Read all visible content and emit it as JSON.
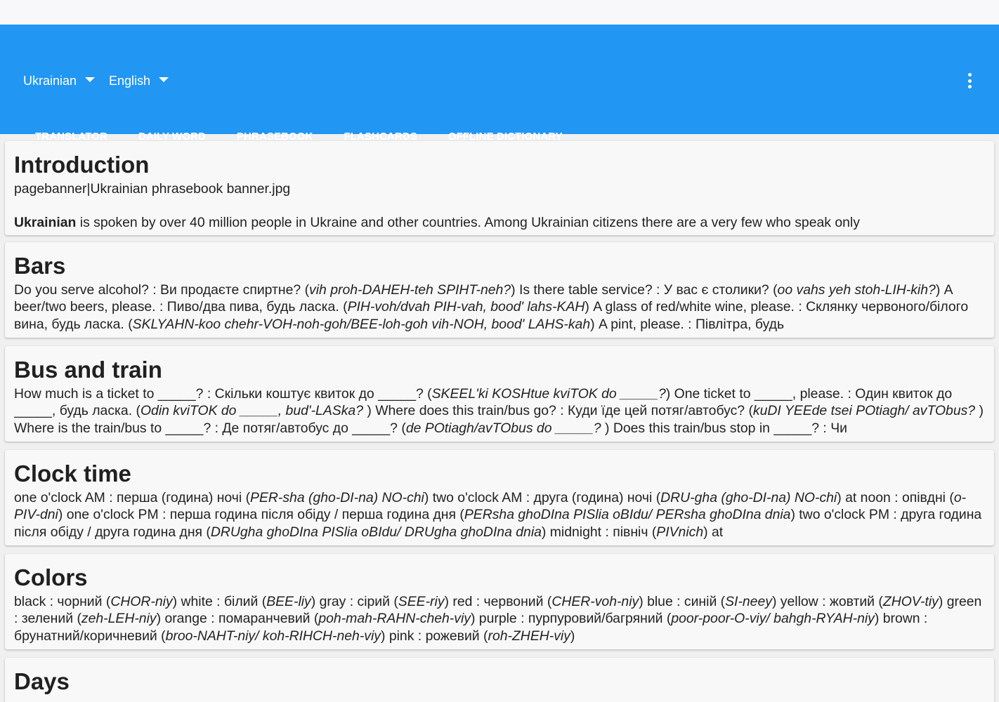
{
  "header": {
    "source_language": "Ukrainian",
    "target_language": "English",
    "menu_icon": "more-vert-icon",
    "accent_color": "#2196f3"
  },
  "tabs": [
    {
      "label": "TRANSLATOR",
      "active": false
    },
    {
      "label": "DAILY WORD",
      "active": false
    },
    {
      "label": "PHRASEBOOK",
      "active": true
    },
    {
      "label": "FLASHCARDS",
      "active": false
    },
    {
      "label": "OFFLINE DICTIONARY",
      "active": false
    }
  ],
  "sections": {
    "intro": {
      "title": "Introduction",
      "banner": "pagebanner|Ukrainian phrasebook banner.jpg",
      "lead_bold": "Ukrainian",
      "lead_rest": " is spoken by over 40 million people in Ukraine and other countries. Among Ukrainian citizens there are a very few who speak only"
    },
    "bars": {
      "title": "Bars",
      "segments": [
        {
          "t": "Do you serve alcohol? : Ви продаєте спиртне? ("
        },
        {
          "t": "vih proh-DAHEH-teh SPIHT-neh?",
          "i": true
        },
        {
          "t": ") Is there table service? : У вас є столики? ("
        },
        {
          "t": "oo vahs yeh stoh-LIH-kih?",
          "i": true
        },
        {
          "t": ") A beer/two beers, please. : Пиво/два пива, будь ласка. ("
        },
        {
          "t": "PIH-voh/dvah PIH-vah, bood' lahs-KAH",
          "i": true
        },
        {
          "t": ") A glass of red/white wine, please. : Склянку червоного/білого вина, будь ласка. ("
        },
        {
          "t": "SKLYAHN-koo chehr-VOH-noh-goh/BEE-loh-goh vih-NOH, bood' LAHS-kah",
          "i": true
        },
        {
          "t": ") A pint, please. : Півлітра, будь"
        }
      ]
    },
    "bus": {
      "title": "Bus and train",
      "segments": [
        {
          "t": "How much is a ticket to _____? : Скільки коштує квиток до _____? ("
        },
        {
          "t": "SKEEL'ki KOSHtue kviTOK do _____?",
          "i": true
        },
        {
          "t": ") One ticket to _____, please. : Один квиток до _____, будь ласка. ("
        },
        {
          "t": "Odin kviTOK do _____, bud'-LASka? ",
          "i": true
        },
        {
          "t": ") Where does this train/bus go? : Куди їде цей потяг/автобус? ("
        },
        {
          "t": "kuDI YEEde tsei POtiagh/ avTObus? ",
          "i": true
        },
        {
          "t": ") Where is the train/bus to _____? : Де потяг/автобус до _____? ("
        },
        {
          "t": "de POtiagh/avTObus do _____? ",
          "i": true
        },
        {
          "t": ") Does this train/bus stop in _____? : Чи"
        }
      ]
    },
    "clock": {
      "title": "Clock time",
      "segments": [
        {
          "t": "one o'clock AM : перша (година) ночі ("
        },
        {
          "t": "PER-sha (gho-DI-na) NO-chi",
          "i": true
        },
        {
          "t": ") two o'clock AM : друга (година) ночі ("
        },
        {
          "t": "DRU-gha (gho-DI-na) NO-chi",
          "i": true
        },
        {
          "t": ") at noon : опівдні ("
        },
        {
          "t": "o-PIV-dni",
          "i": true
        },
        {
          "t": ") one o'clock PM : перша година після обіду / перша година дня ("
        },
        {
          "t": "PERsha ghoDIna PISlia oBIdu/ PERsha ghoDIna dnia",
          "i": true
        },
        {
          "t": ") two o'clock PM : друга година після обіду / друга година дня ("
        },
        {
          "t": "DRUgha ghoDIna PISlia oBIdu/ DRUgha ghoDIna dnia",
          "i": true
        },
        {
          "t": ") midnight : північ ("
        },
        {
          "t": "PIVnich",
          "i": true
        },
        {
          "t": ") at"
        }
      ]
    },
    "colors": {
      "title": "Colors",
      "segments": [
        {
          "t": "black : чорний ("
        },
        {
          "t": "CHOR-niy",
          "i": true
        },
        {
          "t": ") white : білий ("
        },
        {
          "t": "BEE-liy",
          "i": true
        },
        {
          "t": ") gray : сірий ("
        },
        {
          "t": "SEE-riy",
          "i": true
        },
        {
          "t": ") red : червоний ("
        },
        {
          "t": "CHER-voh-niy",
          "i": true
        },
        {
          "t": ") blue : синій ("
        },
        {
          "t": "SI-neey",
          "i": true
        },
        {
          "t": ") yellow : жовтий ("
        },
        {
          "t": "ZHOV-tiy",
          "i": true
        },
        {
          "t": ") green : зелений ("
        },
        {
          "t": "zeh-LEH-niy",
          "i": true
        },
        {
          "t": ") orange : помаранчевий ("
        },
        {
          "t": "poh-mah-RAHN-cheh-viy",
          "i": true
        },
        {
          "t": ") purple : пурпуровий/багряний ("
        },
        {
          "t": "poor-poor-O-viy/ bahgh-RYAH-niy",
          "i": true
        },
        {
          "t": ") brown : брунатний/коричневий ("
        },
        {
          "t": "broo-NAHT-niy/ koh-RIHCH-neh-viy",
          "i": true
        },
        {
          "t": ") pink : рожевий ("
        },
        {
          "t": "roh-ZHEH-viy",
          "i": true
        },
        {
          "t": ")"
        }
      ]
    },
    "days": {
      "title": "Days"
    }
  }
}
